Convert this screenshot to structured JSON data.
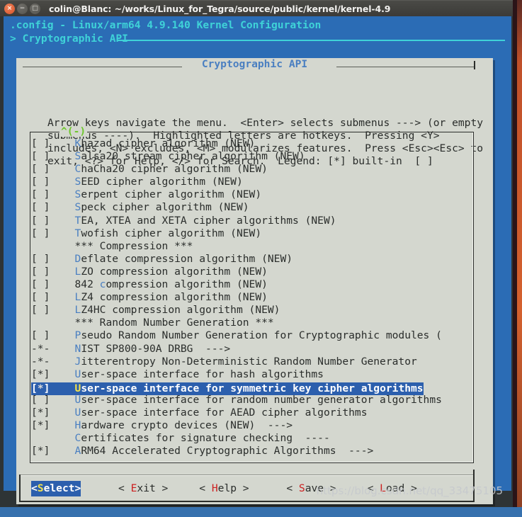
{
  "window": {
    "title": "colin@Blanc: ~/works/Linux_for_Tegra/source/public/kernel/kernel-4.9",
    "close_glyph": "×",
    "minimize_glyph": "−",
    "maximize_glyph": "□"
  },
  "mconf": {
    "header_line1": ".config - Linux/arm64 4.9.140 Kernel Configuration",
    "header_line2": "> Cryptographic API",
    "dialog_title": "Cryptographic API",
    "help_text": "Arrow keys navigate the menu.  <Enter> selects submenus ---> (or empty\nsubmenus ----).  Highlighted letters are hotkeys.  Pressing <Y>\nincludes, <N> excludes, <M> modularizes features.  Press <Esc><Esc> to\nexit, <?> for Help, </> for Search.  Legend: [*] built-in  [ ]",
    "scroll_up_indicator": "^(-)"
  },
  "list": [
    {
      "tag": "[ ]",
      "hot": "K",
      "rest": "hazad cipher algorithm (NEW)",
      "selected": false,
      "type": "option"
    },
    {
      "tag": "[ ]",
      "hot": "S",
      "rest": "alsa20 stream cipher algorithm (NEW)",
      "selected": false,
      "type": "option"
    },
    {
      "tag": "[ ]",
      "hot": "C",
      "rest": "haCha20 cipher algorithm (NEW)",
      "selected": false,
      "type": "option"
    },
    {
      "tag": "[ ]",
      "hot": "S",
      "rest": "EED cipher algorithm (NEW)",
      "selected": false,
      "type": "option"
    },
    {
      "tag": "[ ]",
      "hot": "S",
      "rest": "erpent cipher algorithm (NEW)",
      "selected": false,
      "type": "option"
    },
    {
      "tag": "[ ]",
      "hot": "S",
      "rest": "peck cipher algorithm (NEW)",
      "selected": false,
      "type": "option"
    },
    {
      "tag": "[ ]",
      "hot": "T",
      "rest": "EA, XTEA and XETA cipher algorithms (NEW)",
      "selected": false,
      "type": "option"
    },
    {
      "tag": "[ ]",
      "hot": "T",
      "rest": "wofish cipher algorithm (NEW)",
      "selected": false,
      "type": "option"
    },
    {
      "tag": "   ",
      "hot": "",
      "rest": "*** Compression ***",
      "selected": false,
      "type": "separator"
    },
    {
      "tag": "[ ]",
      "hot": "D",
      "rest": "eflate compression algorithm (NEW)",
      "selected": false,
      "type": "option"
    },
    {
      "tag": "[ ]",
      "hot": "L",
      "rest": "ZO compression algorithm (NEW)",
      "selected": false,
      "type": "option"
    },
    {
      "tag": "[ ]",
      "hot": "",
      "rest": "842 compression algorithm (NEW)",
      "hot_index": 4,
      "selected": false,
      "type": "option"
    },
    {
      "tag": "[ ]",
      "hot": "L",
      "rest": "Z4 compression algorithm (NEW)",
      "selected": false,
      "type": "option"
    },
    {
      "tag": "[ ]",
      "hot": "L",
      "rest": "Z4HC compression algorithm (NEW)",
      "selected": false,
      "type": "option"
    },
    {
      "tag": "   ",
      "hot": "",
      "rest": "*** Random Number Generation ***",
      "selected": false,
      "type": "separator"
    },
    {
      "tag": "[ ]",
      "hot": "P",
      "rest": "seudo Random Number Generation for Cryptographic modules (",
      "selected": false,
      "type": "option"
    },
    {
      "tag": "-*-",
      "hot": "N",
      "rest": "IST SP800-90A DRBG  --->",
      "selected": false,
      "type": "submenu"
    },
    {
      "tag": "-*-",
      "hot": "J",
      "rest": "itterentropy Non-Deterministic Random Number Generator",
      "selected": false,
      "type": "option"
    },
    {
      "tag": "[*]",
      "hot": "U",
      "rest": "ser-space interface for hash algorithms",
      "selected": false,
      "type": "option"
    },
    {
      "tag": "[*]",
      "hot": "U",
      "rest": "ser-space interface for symmetric key cipher algorithms",
      "selected": true,
      "type": "option"
    },
    {
      "tag": "[ ]",
      "hot": "U",
      "rest": "ser-space interface for random number generator algorithms",
      "selected": false,
      "type": "option"
    },
    {
      "tag": "[*]",
      "hot": "U",
      "rest": "ser-space interface for AEAD cipher algorithms",
      "selected": false,
      "type": "option"
    },
    {
      "tag": "[*]",
      "hot": "H",
      "rest": "ardware crypto devices (NEW)  --->",
      "selected": false,
      "type": "submenu"
    },
    {
      "tag": "   ",
      "hot": "C",
      "rest": "ertificates for signature checking  ----",
      "selected": false,
      "type": "submenu"
    },
    {
      "tag": "[*]",
      "hot": "A",
      "rest": "RM64 Accelerated Cryptographic Algorithms  --->",
      "selected": false,
      "type": "submenu"
    }
  ],
  "buttons": [
    {
      "name": "select",
      "pre": "<",
      "hot": "S",
      "post": "elect>",
      "selected": true
    },
    {
      "name": "exit",
      "pre": "< ",
      "hot": "E",
      "post": "xit >",
      "selected": false
    },
    {
      "name": "help",
      "pre": "< ",
      "hot": "H",
      "post": "elp >",
      "selected": false
    },
    {
      "name": "save",
      "pre": "< ",
      "hot": "S",
      "post": "ave >",
      "selected": false
    },
    {
      "name": "load",
      "pre": "< ",
      "hot": "L",
      "post": "oad >",
      "selected": false
    }
  ],
  "watermark": "https://blog.csdn.net/qq_33475105",
  "colors": {
    "desktop": "#3771ae",
    "terminal_bg": "#2e3436",
    "mconf_bg": "#2b6cb5",
    "dialog_bg": "#d4d7cf",
    "header_text": "#3fd2d8",
    "hotkey": "#4a7fc1",
    "selected_bg": "#2c5fad",
    "selected_hotkey": "#f2e14c",
    "button_hotkey": "#cc2020",
    "scroll_indicator": "#6ec72e"
  }
}
